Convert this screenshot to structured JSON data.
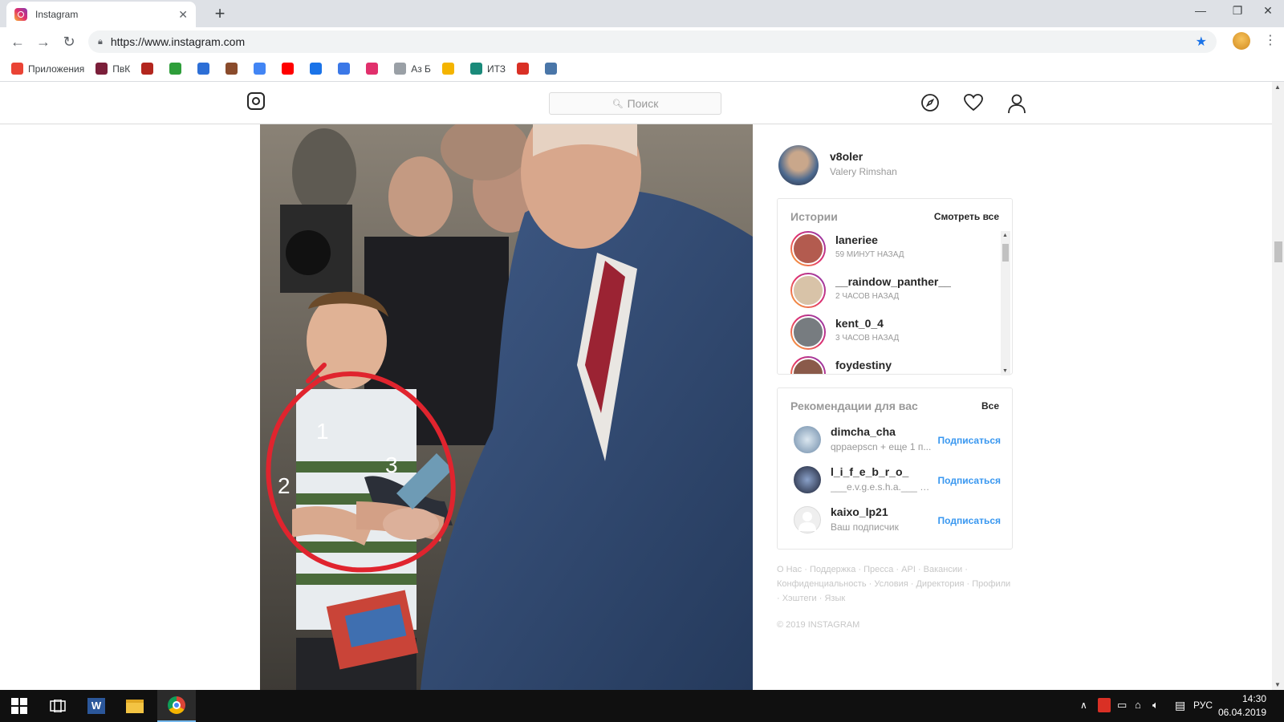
{
  "browser": {
    "tab_title": "Instagram",
    "tab_close": "✕",
    "new_tab": "+",
    "url": "https://www.instagram.com",
    "window_controls": [
      "—",
      "❐",
      "✕"
    ],
    "bookmarks": [
      {
        "label": "Приложения",
        "color": "#ea4335"
      },
      {
        "label": "ПвК",
        "color": "#7b1f3a"
      },
      {
        "label": "",
        "color": "#b3261e"
      },
      {
        "label": "",
        "color": "#2e9e3a"
      },
      {
        "label": "",
        "color": "#2d6fd6"
      },
      {
        "label": "",
        "color": "#8a4b2c"
      },
      {
        "label": "",
        "color": "#4285f4"
      },
      {
        "label": "",
        "color": "#ff0000"
      },
      {
        "label": "",
        "color": "#1a73e8"
      },
      {
        "label": "",
        "color": "#3b78e7"
      },
      {
        "label": "",
        "color": "#e1306c"
      },
      {
        "label": "Аз Б",
        "color": "#9aa0a6"
      },
      {
        "label": "",
        "color": "#f4b400"
      },
      {
        "label": "ИТЗ",
        "color": "#1a8a7a"
      },
      {
        "label": "",
        "color": "#d93025"
      },
      {
        "label": "",
        "color": "#4a76a8"
      }
    ]
  },
  "instagram": {
    "search_placeholder": "Поиск",
    "icons": [
      "explore-icon",
      "heart-icon",
      "profile-icon"
    ],
    "photo_annotations": [
      "1",
      "2",
      "3"
    ],
    "me": {
      "username": "v8oler",
      "fullname": "Valery Rimshan"
    },
    "stories": {
      "title": "Истории",
      "see_all": "Смотреть все",
      "items": [
        {
          "name": "laneriee",
          "time": "59 МИНУТ НАЗАД"
        },
        {
          "name": "__raindow_panther__",
          "time": "2 ЧАСОВ НАЗАД"
        },
        {
          "name": "kent_0_4",
          "time": "3 ЧАСОВ НАЗАД"
        },
        {
          "name": "foydestiny",
          "time": ""
        }
      ]
    },
    "recommendations": {
      "title": "Рекомендации для вас",
      "all": "Все",
      "items": [
        {
          "name": "dimcha_cha",
          "sub": "qppaepscn + еще 1 п...",
          "follow": "Подписаться"
        },
        {
          "name": "l_i_f_e_b_r_o_",
          "sub": "___e.v.g.e.s.h.a.___ + е...",
          "follow": "Подписаться"
        },
        {
          "name": "kaixo_lp21",
          "sub": "Ваш подписчик",
          "follow": "Подписаться"
        }
      ]
    },
    "footer_links": "О Нас · Поддержка · Пресса · API · Вакансии · Конфиденциальность · Условия · Директория · Профили · Хэштеги · Язык",
    "copyright": "© 2019 INSTAGRAM"
  },
  "taskbar": {
    "lang": "РУС",
    "time": "14:30",
    "date": "06.04.2019"
  }
}
